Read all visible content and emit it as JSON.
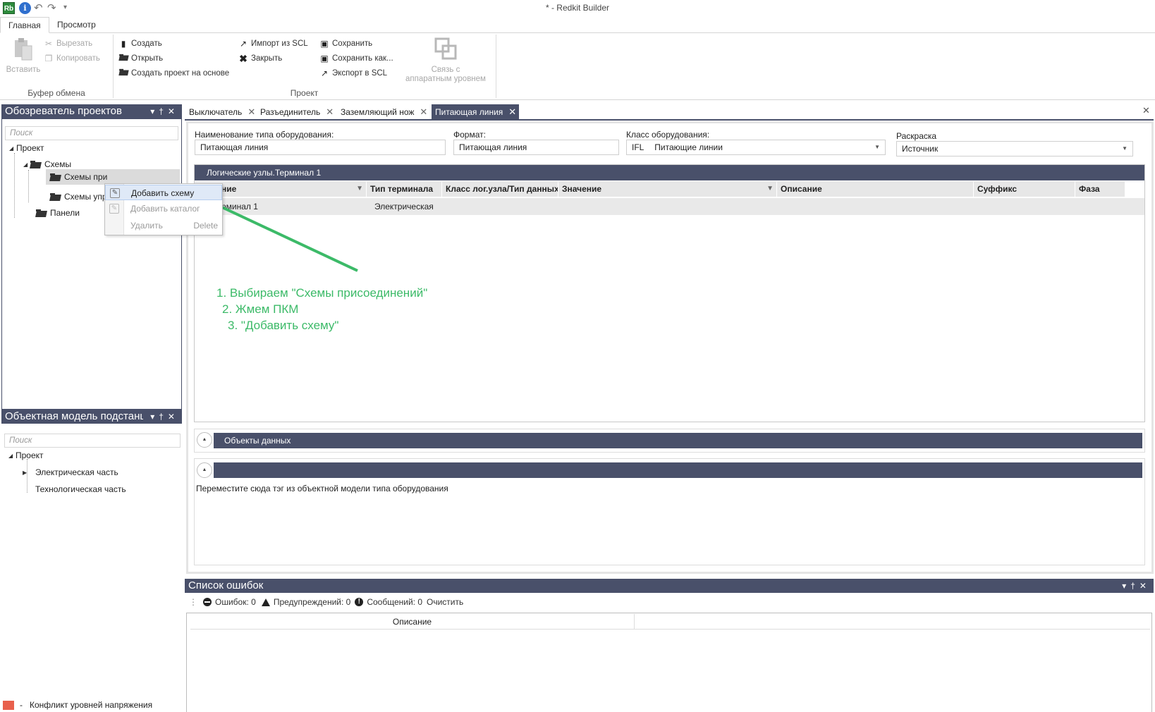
{
  "window": {
    "title": "* - Redkit Builder",
    "app_icon_text": "Rb",
    "info_icon_text": "i"
  },
  "ribbon": {
    "tabs": [
      {
        "label": "Главная",
        "active": true
      },
      {
        "label": "Просмотр",
        "active": false
      }
    ],
    "clipboard_group": {
      "label": "Буфер обмена",
      "paste": "Вставить",
      "cut": "Вырезать",
      "copy": "Копировать"
    },
    "project_group": {
      "label": "Проект",
      "create": "Создать",
      "open": "Открыть",
      "create_from": "Создать проект на основе",
      "import_scl": "Импорт из SCL",
      "close": "Закрыть",
      "save": "Сохранить",
      "save_as": "Сохранить как...",
      "export_scl": "Экспорт в SCL",
      "hw_link_line1": "Связь с",
      "hw_link_line2": "аппаратным уровнем"
    }
  },
  "project_explorer": {
    "title": "Обозреватель проектов",
    "search_placeholder": "Поиск",
    "tree": {
      "root": "Проект",
      "schemes": "Схемы",
      "scheme_conn": "Схемы при",
      "scheme_ctrl": "Схемы упр",
      "panels": "Панели"
    }
  },
  "context_menu": {
    "add_scheme": "Добавить схему",
    "add_catalog": "Добавить каталог",
    "delete": "Удалить",
    "delete_shortcut": "Delete"
  },
  "object_model": {
    "title": "Объектная модель подстанции",
    "search_placeholder": "Поиск",
    "tree": {
      "root": "Проект",
      "electrical": "Электрическая часть",
      "technological": "Технологическая часть"
    },
    "legend": {
      "color": "#e8604c",
      "dash": "-",
      "label": "Конфликт уровней напряжения"
    }
  },
  "doc_tabs": [
    {
      "label": "Выключатель",
      "active": false
    },
    {
      "label": "Разъединитель",
      "active": false
    },
    {
      "label": "Заземляющий нож",
      "active": false
    },
    {
      "label": "Питающая линия",
      "active": true
    }
  ],
  "form": {
    "type_name_label": "Наименование типа оборудования:",
    "type_name_value": "Питающая линия",
    "format_label": "Формат:",
    "format_value": "Питающая линия",
    "class_label": "Класс оборудования:",
    "class_code": "IFL",
    "class_value": "Питающие линии",
    "coloring_label": "Раскраска",
    "coloring_value": "Источник"
  },
  "logical_nodes": {
    "title": "Логические узлы.Терминал 1",
    "columns": [
      "ние",
      "Тип терминала",
      "Класс лог.узла/Тип данных",
      "Значение",
      "Описание",
      "Суффикс",
      "Фаза"
    ],
    "rows": [
      {
        "name": "рминал 1",
        "terminal_type": "Электрическая"
      }
    ]
  },
  "annotation": {
    "line1": "1. Выбираем \"Схемы присоединений\"",
    "line2": "2. Жмем ПКМ",
    "line3": "3. \"Добавить схему\"",
    "color": "#3cba68"
  },
  "data_objects": {
    "title": "Объекты данных"
  },
  "tag_drop": {
    "hint": "Переместите сюда тэг из объектной модели типа оборудования"
  },
  "error_list": {
    "title": "Список ошибок",
    "errors": "Ошибок: 0",
    "warnings": "Предупреждений: 0",
    "messages": "Сообщений: 0",
    "clear": "Очистить",
    "column_description": "Описание"
  },
  "colors": {
    "panel_header": "#49506a",
    "annotation_green": "#3cba68"
  }
}
